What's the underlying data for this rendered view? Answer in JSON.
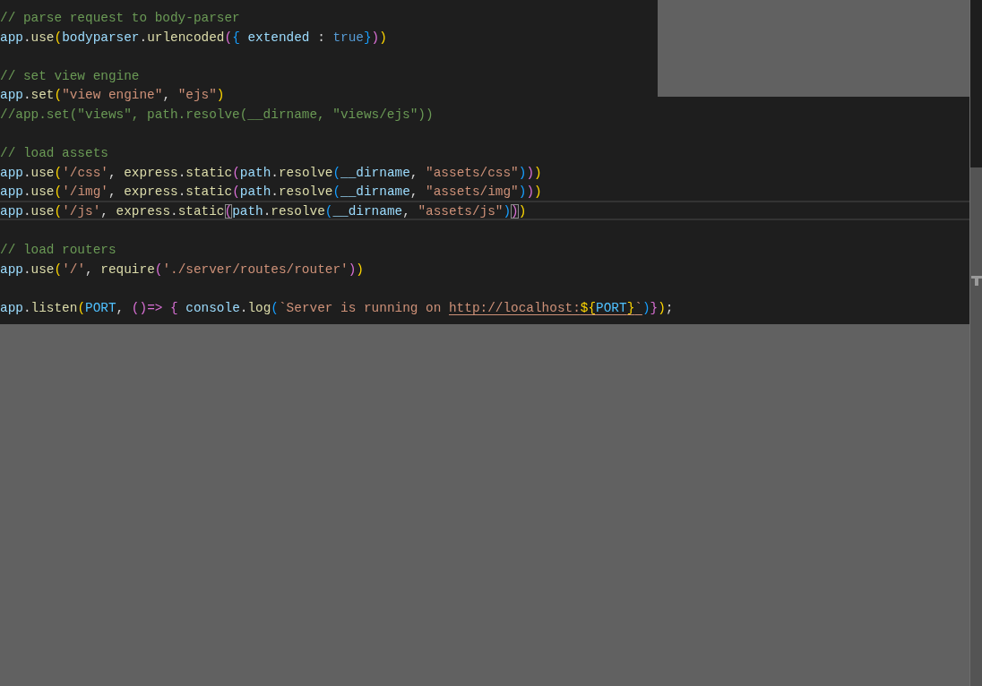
{
  "editor": {
    "lines": [
      {
        "kind": "code",
        "current": false,
        "tokens": [
          {
            "text": "// parse request to body-parser",
            "kind": "comment"
          }
        ]
      },
      {
        "kind": "code",
        "current": false,
        "tokens": [
          {
            "text": "app",
            "kind": "var"
          },
          {
            "text": ".",
            "kind": "punct"
          },
          {
            "text": "use",
            "kind": "func"
          },
          {
            "text": "(",
            "kind": "bracket1"
          },
          {
            "text": "bodyparser",
            "kind": "var"
          },
          {
            "text": ".",
            "kind": "punct"
          },
          {
            "text": "urlencoded",
            "kind": "func"
          },
          {
            "text": "(",
            "kind": "bracket2"
          },
          {
            "text": "{",
            "kind": "bracket3"
          },
          {
            "text": " extended ",
            "kind": "var"
          },
          {
            "text": ":",
            "kind": "punct"
          },
          {
            "text": " true",
            "kind": "keyword"
          },
          {
            "text": "}",
            "kind": "bracket3"
          },
          {
            "text": ")",
            "kind": "bracket2"
          },
          {
            "text": ")",
            "kind": "bracket1"
          }
        ]
      },
      {
        "kind": "blank"
      },
      {
        "kind": "code",
        "current": false,
        "tokens": [
          {
            "text": "// set view engine",
            "kind": "comment"
          }
        ]
      },
      {
        "kind": "code",
        "current": false,
        "tokens": [
          {
            "text": "app",
            "kind": "var"
          },
          {
            "text": ".",
            "kind": "punct"
          },
          {
            "text": "set",
            "kind": "func"
          },
          {
            "text": "(",
            "kind": "bracket1"
          },
          {
            "text": "\"view engine\"",
            "kind": "string"
          },
          {
            "text": ", ",
            "kind": "punct"
          },
          {
            "text": "\"ejs\"",
            "kind": "string"
          },
          {
            "text": ")",
            "kind": "bracket1"
          }
        ]
      },
      {
        "kind": "code",
        "current": false,
        "tokens": [
          {
            "text": "//app.set(\"views\", path.resolve(__dirname, \"views/ejs\"))",
            "kind": "comment"
          }
        ]
      },
      {
        "kind": "blank"
      },
      {
        "kind": "code",
        "current": false,
        "tokens": [
          {
            "text": "// load assets",
            "kind": "comment"
          }
        ]
      },
      {
        "kind": "code",
        "current": false,
        "tokens": [
          {
            "text": "app",
            "kind": "var"
          },
          {
            "text": ".",
            "kind": "punct"
          },
          {
            "text": "use",
            "kind": "func"
          },
          {
            "text": "(",
            "kind": "bracket1"
          },
          {
            "text": "'/css'",
            "kind": "string"
          },
          {
            "text": ", ",
            "kind": "punct"
          },
          {
            "text": "express",
            "kind": "func"
          },
          {
            "text": ".",
            "kind": "punct"
          },
          {
            "text": "static",
            "kind": "func"
          },
          {
            "text": "(",
            "kind": "bracket2"
          },
          {
            "text": "path",
            "kind": "var"
          },
          {
            "text": ".",
            "kind": "punct"
          },
          {
            "text": "resolve",
            "kind": "func"
          },
          {
            "text": "(",
            "kind": "bracket3"
          },
          {
            "text": "__dirname",
            "kind": "var"
          },
          {
            "text": ", ",
            "kind": "punct"
          },
          {
            "text": "\"assets/css\"",
            "kind": "string"
          },
          {
            "text": ")",
            "kind": "bracket3"
          },
          {
            "text": ")",
            "kind": "bracket2"
          },
          {
            "text": ")",
            "kind": "bracket1"
          }
        ]
      },
      {
        "kind": "code",
        "current": false,
        "tokens": [
          {
            "text": "app",
            "kind": "var"
          },
          {
            "text": ".",
            "kind": "punct"
          },
          {
            "text": "use",
            "kind": "func"
          },
          {
            "text": "(",
            "kind": "bracket1"
          },
          {
            "text": "'/img'",
            "kind": "string"
          },
          {
            "text": ", ",
            "kind": "punct"
          },
          {
            "text": "express",
            "kind": "func"
          },
          {
            "text": ".",
            "kind": "punct"
          },
          {
            "text": "static",
            "kind": "func"
          },
          {
            "text": "(",
            "kind": "bracket2"
          },
          {
            "text": "path",
            "kind": "var"
          },
          {
            "text": ".",
            "kind": "punct"
          },
          {
            "text": "resolve",
            "kind": "func"
          },
          {
            "text": "(",
            "kind": "bracket3"
          },
          {
            "text": "__dirname",
            "kind": "var"
          },
          {
            "text": ", ",
            "kind": "punct"
          },
          {
            "text": "\"assets/img\"",
            "kind": "string"
          },
          {
            "text": ")",
            "kind": "bracket3"
          },
          {
            "text": ")",
            "kind": "bracket2"
          },
          {
            "text": ")",
            "kind": "bracket1"
          }
        ]
      },
      {
        "kind": "code",
        "current": true,
        "tokens": [
          {
            "text": "app",
            "kind": "var"
          },
          {
            "text": ".",
            "kind": "punct"
          },
          {
            "text": "use",
            "kind": "func"
          },
          {
            "text": "(",
            "kind": "bracket1"
          },
          {
            "text": "'/js'",
            "kind": "string"
          },
          {
            "text": ", ",
            "kind": "punct"
          },
          {
            "text": "express",
            "kind": "func"
          },
          {
            "text": ".",
            "kind": "punct"
          },
          {
            "text": "static",
            "kind": "func"
          },
          {
            "text": "(",
            "kind": "bracket2",
            "matched": true
          },
          {
            "text": "path",
            "kind": "var"
          },
          {
            "text": ".",
            "kind": "punct"
          },
          {
            "text": "resolve",
            "kind": "func"
          },
          {
            "text": "(",
            "kind": "bracket3"
          },
          {
            "text": "__dirname",
            "kind": "var"
          },
          {
            "text": ", ",
            "kind": "punct"
          },
          {
            "text": "\"assets/js\"",
            "kind": "string"
          },
          {
            "text": ")",
            "kind": "bracket3"
          },
          {
            "text": ")",
            "kind": "bracket2",
            "matched": true
          },
          {
            "text": ")",
            "kind": "bracket1"
          }
        ]
      },
      {
        "kind": "blank"
      },
      {
        "kind": "code",
        "current": false,
        "tokens": [
          {
            "text": "// load routers",
            "kind": "comment"
          }
        ]
      },
      {
        "kind": "code",
        "current": false,
        "tokens": [
          {
            "text": "app",
            "kind": "var"
          },
          {
            "text": ".",
            "kind": "punct"
          },
          {
            "text": "use",
            "kind": "func"
          },
          {
            "text": "(",
            "kind": "bracket1"
          },
          {
            "text": "'/'",
            "kind": "string"
          },
          {
            "text": ", ",
            "kind": "punct"
          },
          {
            "text": "require",
            "kind": "func"
          },
          {
            "text": "(",
            "kind": "bracket2"
          },
          {
            "text": "'./server/routes/router'",
            "kind": "string"
          },
          {
            "text": ")",
            "kind": "bracket2"
          },
          {
            "text": ")",
            "kind": "bracket1"
          }
        ]
      },
      {
        "kind": "blank"
      },
      {
        "kind": "code",
        "current": false,
        "tokens": [
          {
            "text": "app",
            "kind": "var"
          },
          {
            "text": ".",
            "kind": "punct"
          },
          {
            "text": "listen",
            "kind": "func"
          },
          {
            "text": "(",
            "kind": "bracket1"
          },
          {
            "text": "PORT",
            "kind": "constant"
          },
          {
            "text": ", ",
            "kind": "punct"
          },
          {
            "text": "()=>",
            "kind": "bracket2"
          },
          {
            "text": " {",
            "kind": "bracket2"
          },
          {
            "text": " console",
            "kind": "var"
          },
          {
            "text": ".",
            "kind": "punct"
          },
          {
            "text": "log",
            "kind": "func"
          },
          {
            "text": "(",
            "kind": "bracket3"
          },
          {
            "text": "`Server is running on ",
            "kind": "string"
          },
          {
            "text": "http://localhost:",
            "kind": "string",
            "underlined": true
          },
          {
            "text": "${",
            "kind": "bracket1",
            "underlined": true
          },
          {
            "text": "PORT",
            "kind": "constant",
            "underlined": true
          },
          {
            "text": "}",
            "kind": "bracket1",
            "underlined": true
          },
          {
            "text": "`",
            "kind": "string",
            "underlined": true
          },
          {
            "text": ")",
            "kind": "bracket3"
          },
          {
            "text": "}",
            "kind": "bracket2"
          },
          {
            "text": ")",
            "kind": "bracket1"
          },
          {
            "text": ";",
            "kind": "punct"
          }
        ]
      }
    ]
  }
}
